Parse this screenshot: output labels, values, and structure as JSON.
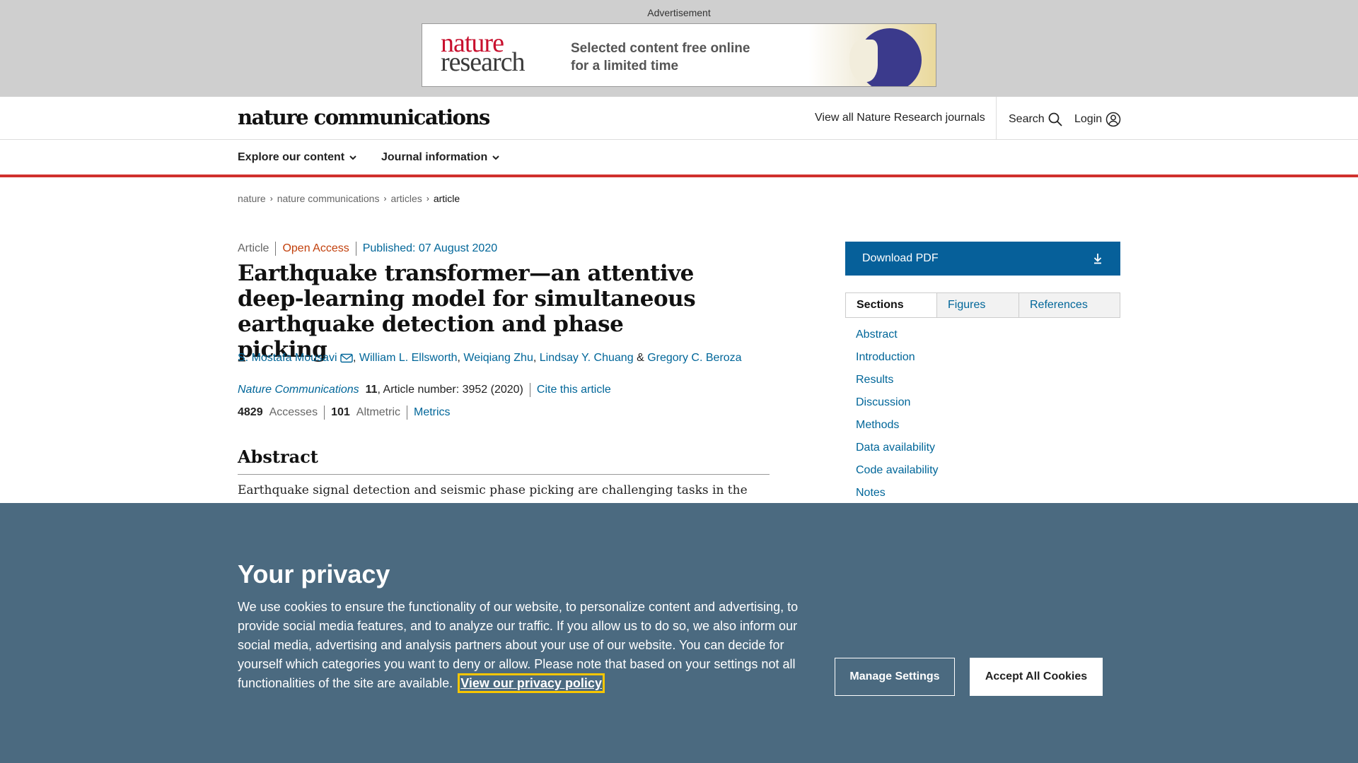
{
  "ad": {
    "label": "Advertisement",
    "logo_line1": "nature",
    "logo_line2": "research",
    "tagline1": "Selected content free online",
    "tagline2": "for a limited time"
  },
  "header": {
    "brand": "nature communications",
    "journals_link": "View all Nature Research journals",
    "search_label": "Search",
    "login_label": "Login"
  },
  "nav": {
    "items": [
      {
        "label": "Explore our content"
      },
      {
        "label": "Journal information"
      }
    ]
  },
  "breadcrumb": [
    "nature",
    "nature communications",
    "articles",
    "article"
  ],
  "article": {
    "type": "Article",
    "access": "Open Access",
    "published": "Published: 07 August 2020",
    "title": "Earthquake transformer—an attentive deep-learning model for simultaneous earthquake detection and phase picking",
    "authors": [
      "S. Mostafa Mousavi",
      "William L. Ellsworth",
      "Weiqiang Zhu",
      "Lindsay Y. Chuang",
      "Gregory C. Beroza"
    ],
    "amp": "&",
    "journal": "Nature Communications",
    "volume": "11",
    "article_number": ", Article number: 3952 (2020)",
    "cite": "Cite this article",
    "accesses_value": "4829",
    "accesses_label": "Accesses",
    "altmetric_value": "101",
    "altmetric_label": "Altmetric",
    "metrics_link": "Metrics",
    "abstract_heading": "Abstract",
    "abstract_start": "Earthquake signal detection and seismic phase picking are challenging tasks in the"
  },
  "sidebar": {
    "download": "Download PDF",
    "tabs": [
      "Sections",
      "Figures",
      "References"
    ],
    "sections": [
      "Abstract",
      "Introduction",
      "Results",
      "Discussion",
      "Methods",
      "Data availability",
      "Code availability",
      "Notes"
    ]
  },
  "cookie": {
    "title": "Your privacy",
    "text": "We use cookies to ensure the functionality of our website, to personalize content and advertising, to provide social media features, and to analyze our traffic. If you allow us to do so, we also inform our social media, advertising and analysis partners about your use of our website. You can decide for yourself which categories you want to deny or allow. Please note that based on your settings not all functionalities of the site are available.",
    "policy_link": "View our privacy policy",
    "manage": "Manage Settings",
    "accept": "Accept All Cookies"
  }
}
